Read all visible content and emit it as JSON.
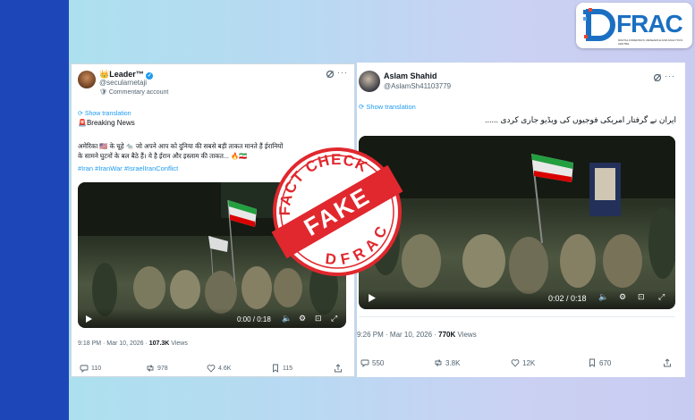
{
  "logo": {
    "text": "FRAC",
    "brand_color": "#1b6fc2",
    "accent": "#e8452f",
    "sub": "DIGITAL FORENSICS, RESEARCH AND ANALYTICS CENTRE"
  },
  "left_tweet": {
    "name": "Leader™",
    "handle": "@secularnetaji",
    "account_tag": "Commentary account",
    "show_translation": "Show translation",
    "breaking": "Breaking News",
    "body_line1": "अमेरिका 🇺🇸 के चूहे 🐀 जो अपने आप को दुनिया की सबसे बड़ी ताकत मानते हैं ईरानियों",
    "body_line2": "के सामने घुटनों के बल बैठे हैं। ये है ईरान और इस्लाम की ताकत... 🔥🇮🇷",
    "hashtags": "#Iran #IranWar #IsraelIranConflict",
    "video_time": "0:00 / 0:18",
    "timestamp": "9:18 PM · Mar 10, 2026 · ",
    "views_count": "107.3K",
    "views_label": " Views",
    "replies": "110",
    "reposts": "978",
    "likes": "4.6K",
    "bookmarks": "115"
  },
  "right_tweet": {
    "name": "Aslam Shahid",
    "handle": "@AslamSh41103779",
    "show_translation": "Show translation",
    "body": "ایران نے گرفتار امریکی فوجیوں کی ویڈیو جاری کردی ......",
    "video_time": "0:02 / 0:18",
    "timestamp": "9:26 PM · Mar 10, 2026 · ",
    "views_count": "770K",
    "views_label": " Views",
    "replies": "550",
    "reposts": "3.8K",
    "likes": "12K",
    "bookmarks": "670"
  },
  "stamp": {
    "top_text": "FACT CHECK",
    "bottom_text": "DFRAC",
    "label": "FAKE",
    "color": "#e0282e"
  },
  "icons": [
    "grok-icon",
    "more-icon",
    "play-icon",
    "volume-icon",
    "settings-icon",
    "fullscreen-icon",
    "reply-icon",
    "repost-icon",
    "like-icon",
    "bookmark-icon",
    "share-icon"
  ]
}
